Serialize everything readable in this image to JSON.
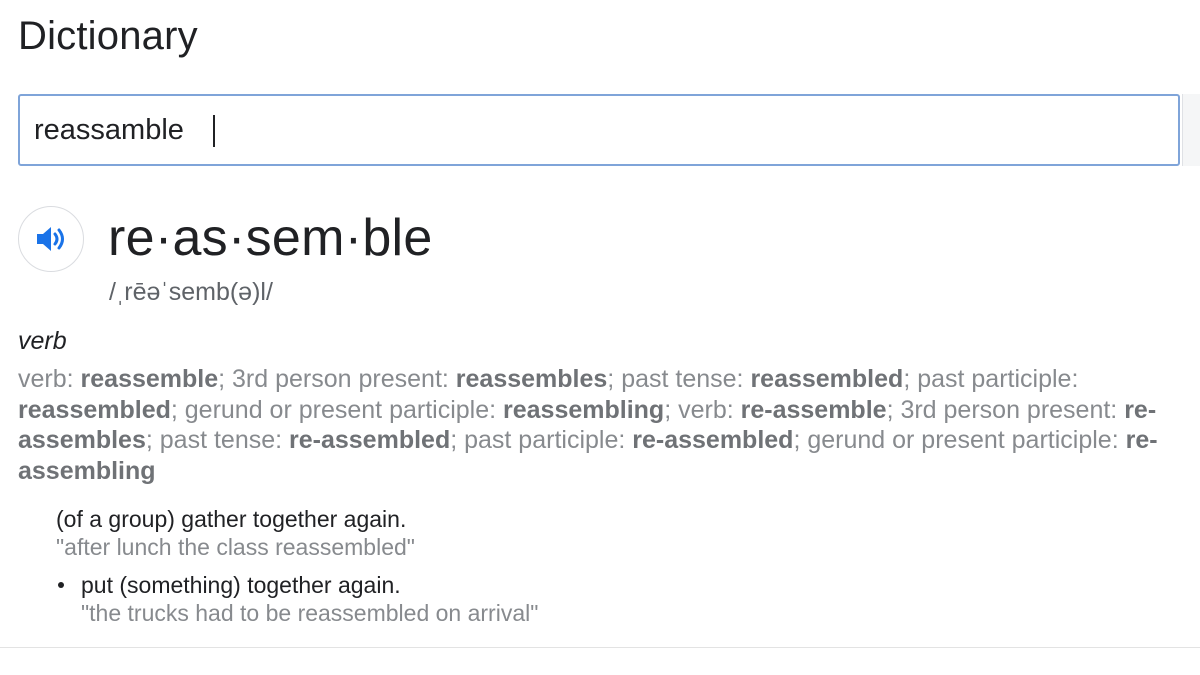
{
  "header": {
    "title": "Dictionary"
  },
  "search": {
    "value": "reassamble"
  },
  "entry": {
    "headword": "re·as·sem·ble",
    "phonetic": "/ˌrēəˈsemb(ə)l/",
    "part_of_speech": "verb",
    "forms": {
      "line1": {
        "t1": "verb: ",
        "b1": "reassemble",
        "t2": "; 3rd person present: ",
        "b2": "reassembles",
        "t3": "; past tense: ",
        "b3": "reassembled",
        "t4": "; past participle:"
      },
      "line2": {
        "b1": "reassembled",
        "t1": "; gerund or present participle: ",
        "b2": "reassembling",
        "t2": "; verb: ",
        "b3": "re-assemble",
        "t3": "; 3rd person present: ",
        "b4": "re-"
      },
      "line3": {
        "b1": "assembles",
        "t1": "; past tense: ",
        "b2": "re-assembled",
        "t2": "; past participle: ",
        "b3": "re-assembled",
        "t3": "; gerund or present participle: ",
        "b4": "re-"
      },
      "line4": {
        "b1": "assembling"
      }
    },
    "senses": [
      {
        "definition": "(of a group) gather together again.",
        "example": "\"after lunch the class reassembled\""
      },
      {
        "definition": "put (something) together again.",
        "example": "\"the trucks had to be reassembled on arrival\""
      }
    ]
  },
  "icons": {
    "audio": "speaker-icon",
    "accent_color": "#1a73e8"
  }
}
